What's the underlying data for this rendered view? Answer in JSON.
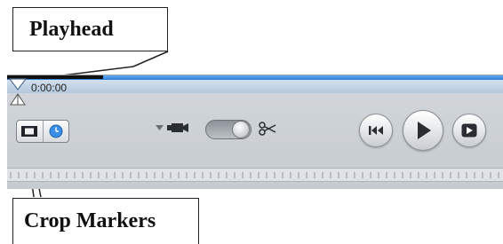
{
  "callouts": {
    "playhead": "Playhead",
    "crop_markers": "Crop Markers"
  },
  "timeline": {
    "timecode": "0:00:00",
    "progress_color": "#2f7fd6"
  },
  "icons": {
    "view_toggle": [
      "filmstrip-icon",
      "clock-icon"
    ],
    "split": "scissors-icon",
    "transport": [
      "rewind-icon",
      "play-icon",
      "next-icon"
    ]
  }
}
